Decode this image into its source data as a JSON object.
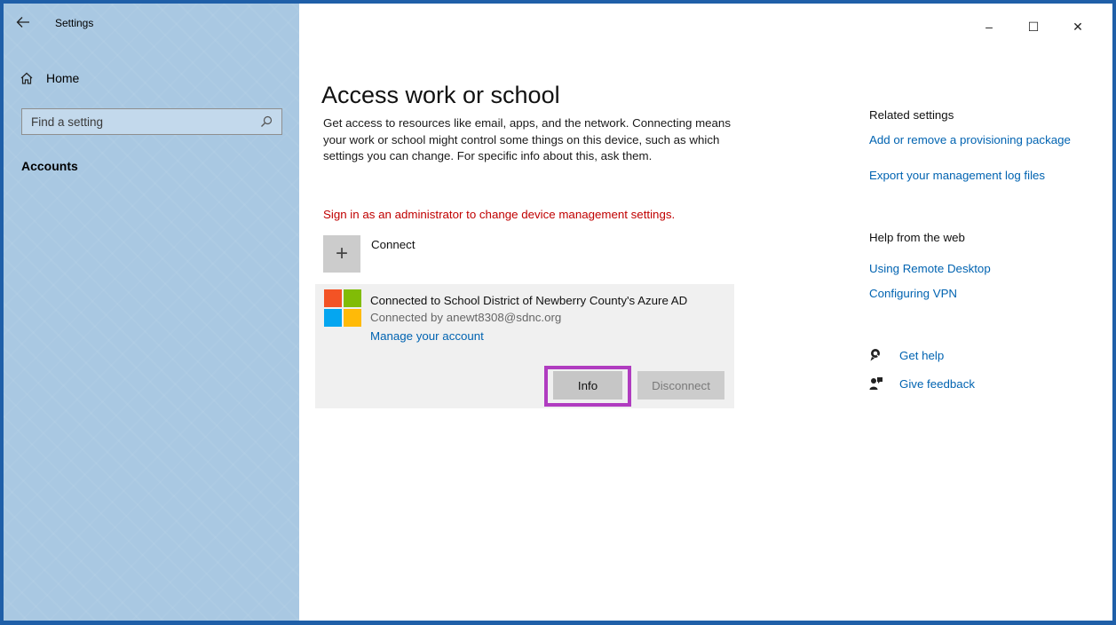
{
  "window": {
    "title": "Settings",
    "minimize": "–",
    "maximize": "☐",
    "close": "✕"
  },
  "sidebar": {
    "home_label": "Home",
    "search_placeholder": "Find a setting",
    "section_label": "Accounts"
  },
  "main": {
    "page_title": "Access work or school",
    "description": "Get access to resources like email, apps, and the network. Connecting means your work or school might control some things on this device, such as which settings you can change. For specific info about this, ask them.",
    "admin_warning": "Sign in as an administrator to change device management settings.",
    "connect_label": "Connect",
    "connect_plus": "+",
    "account": {
      "title": "Connected to School District of Newberry County's Azure AD",
      "subtitle": "Connected by anewt8308@sdnc.org",
      "manage_link": "Manage your account",
      "info_label": "Info",
      "disconnect_label": "Disconnect"
    }
  },
  "related": {
    "heading": "Related settings",
    "links": [
      "Add or remove a provisioning package",
      "Export your management log files"
    ]
  },
  "help": {
    "heading": "Help from the web",
    "links": [
      "Using Remote Desktop",
      "Configuring VPN"
    ],
    "get_help": "Get help",
    "give_feedback": "Give feedback"
  },
  "colors": {
    "sidebar_bg": "#a9c8e2",
    "link": "#0063b1",
    "warning": "#c00000",
    "highlight": "#b03cc0",
    "ms_red": "#f35325",
    "ms_green": "#81bc06",
    "ms_blue": "#05a6f0",
    "ms_yellow": "#ffba08"
  }
}
